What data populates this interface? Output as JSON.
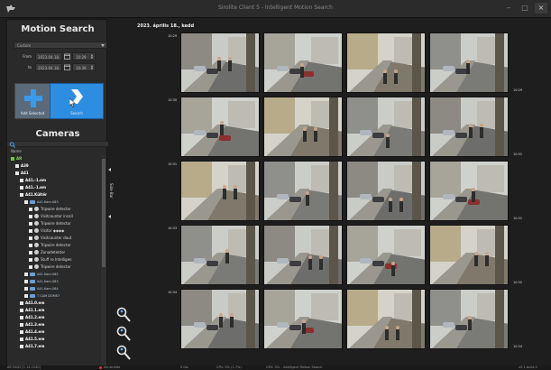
{
  "window": {
    "title": "Sirolite Client 5 - Intelligent Motion Search",
    "buttons": [
      "–",
      "□",
      "×"
    ]
  },
  "sidebar": {
    "title": "Motion Search",
    "select_value": "Custom",
    "from": {
      "label": "From",
      "date": "2023.04.18.",
      "time": "10:29"
    },
    "to": {
      "label": "to",
      "date": "2023.04.18.",
      "time": "10:39"
    },
    "add_button": {
      "label": "Add Selected",
      "icon": "plus-icon",
      "color": "#5a6a7a"
    },
    "search_button": {
      "label": "Search",
      "icon": "chevron-right-icon",
      "color": "#2d8de0"
    },
    "cameras_title": "Cameras",
    "name_column": "Name",
    "handle_label": "Side Bar",
    "tree": [
      {
        "label": "AR",
        "level": 0,
        "kind": "green"
      },
      {
        "label": "A39",
        "level": 1,
        "kind": "bold"
      },
      {
        "label": "A41",
        "level": 1,
        "kind": "bold"
      },
      {
        "label": "A41.-1.em",
        "level": 2,
        "kind": "bold"
      },
      {
        "label": "A41.-1.em",
        "level": 2,
        "kind": "bold"
      },
      {
        "label": "A41.Kültér",
        "level": 2,
        "kind": "bold"
      },
      {
        "label": "A41.Kam.083",
        "level": 3,
        "kind": "cam"
      },
      {
        "label": "Tripwire detector",
        "level": 4,
        "kind": "rule"
      },
      {
        "label": "Visitcounter incoll",
        "level": 4,
        "kind": "rule"
      },
      {
        "label": "Tripwire detector",
        "level": 4,
        "kind": "rule"
      },
      {
        "label": "Visitor ◆◆◆◆",
        "level": 4,
        "kind": "rule"
      },
      {
        "label": "Visitcounter dout",
        "level": 4,
        "kind": "rule"
      },
      {
        "label": "Tripwire detector",
        "level": 4,
        "kind": "rule"
      },
      {
        "label": "Zonadetektor",
        "level": 4,
        "kind": "rule"
      },
      {
        "label": "Stuff re Intelligen",
        "level": 4,
        "kind": "rule"
      },
      {
        "label": "Tripwire detector",
        "level": 4,
        "kind": "rule"
      },
      {
        "label": "A41.Kam.082",
        "level": 3,
        "kind": "cam"
      },
      {
        "label": "A41.Kam.083",
        "level": 3,
        "kind": "cam"
      },
      {
        "label": "A41.Kam.084",
        "level": 3,
        "kind": "cam"
      },
      {
        "label": "T CAM DOME7",
        "level": 3,
        "kind": "cam"
      },
      {
        "label": "A41.0.em",
        "level": 2,
        "kind": "bold"
      },
      {
        "label": "A41.1.em",
        "level": 2,
        "kind": "bold"
      },
      {
        "label": "A41.2.em",
        "level": 2,
        "kind": "bold"
      },
      {
        "label": "A41.3.em",
        "level": 2,
        "kind": "bold"
      },
      {
        "label": "A41.4.em",
        "level": 2,
        "kind": "bold"
      },
      {
        "label": "A41.5.em",
        "level": 2,
        "kind": "bold"
      },
      {
        "label": "A41.7.em",
        "level": 2,
        "kind": "bold"
      }
    ]
  },
  "results": {
    "date": "2023. április 18., kedd",
    "left_times": [
      "10:29",
      "10:30",
      "10:31",
      "10:33",
      "10:34"
    ],
    "right_times": [
      "10:29",
      "10:31",
      "10:31",
      "10:32",
      "10:34"
    ],
    "rows": 5,
    "cols": 4
  },
  "status": {
    "left": "AR DSS2 [1.14.1240]",
    "record": "rec.sirolite",
    "fps": "0 fps",
    "cpu": "CPU: 0% (1.7%)",
    "gpu": "GPU: 0% - Intelligent Motion Search",
    "version": "v5.1.build.0"
  },
  "colors": {
    "background": "#1e1e1e",
    "panel": "#2a2a2a",
    "accent": "#2d8de0",
    "tree_green": "#74c44e"
  }
}
